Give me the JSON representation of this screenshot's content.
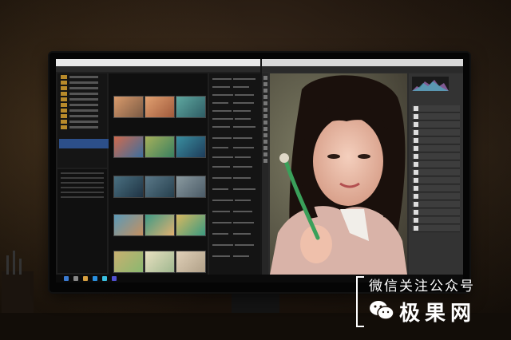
{
  "watermark": {
    "line1": "微信关注公众号",
    "line2": "极果网"
  },
  "photo": {
    "description_colors": {
      "skin": "#e8b9a6",
      "hair": "#1a100c",
      "background": "#6b6a55",
      "sweater": "#d9b3a8",
      "collar": "#f1eee9",
      "pen": "#3aa05a"
    }
  },
  "icons": {
    "wechat": "wechat-icon"
  },
  "colors": {
    "selection": "#2c4f8a",
    "folder": "#b88a2a",
    "titlebar": "#e9e9e9"
  }
}
